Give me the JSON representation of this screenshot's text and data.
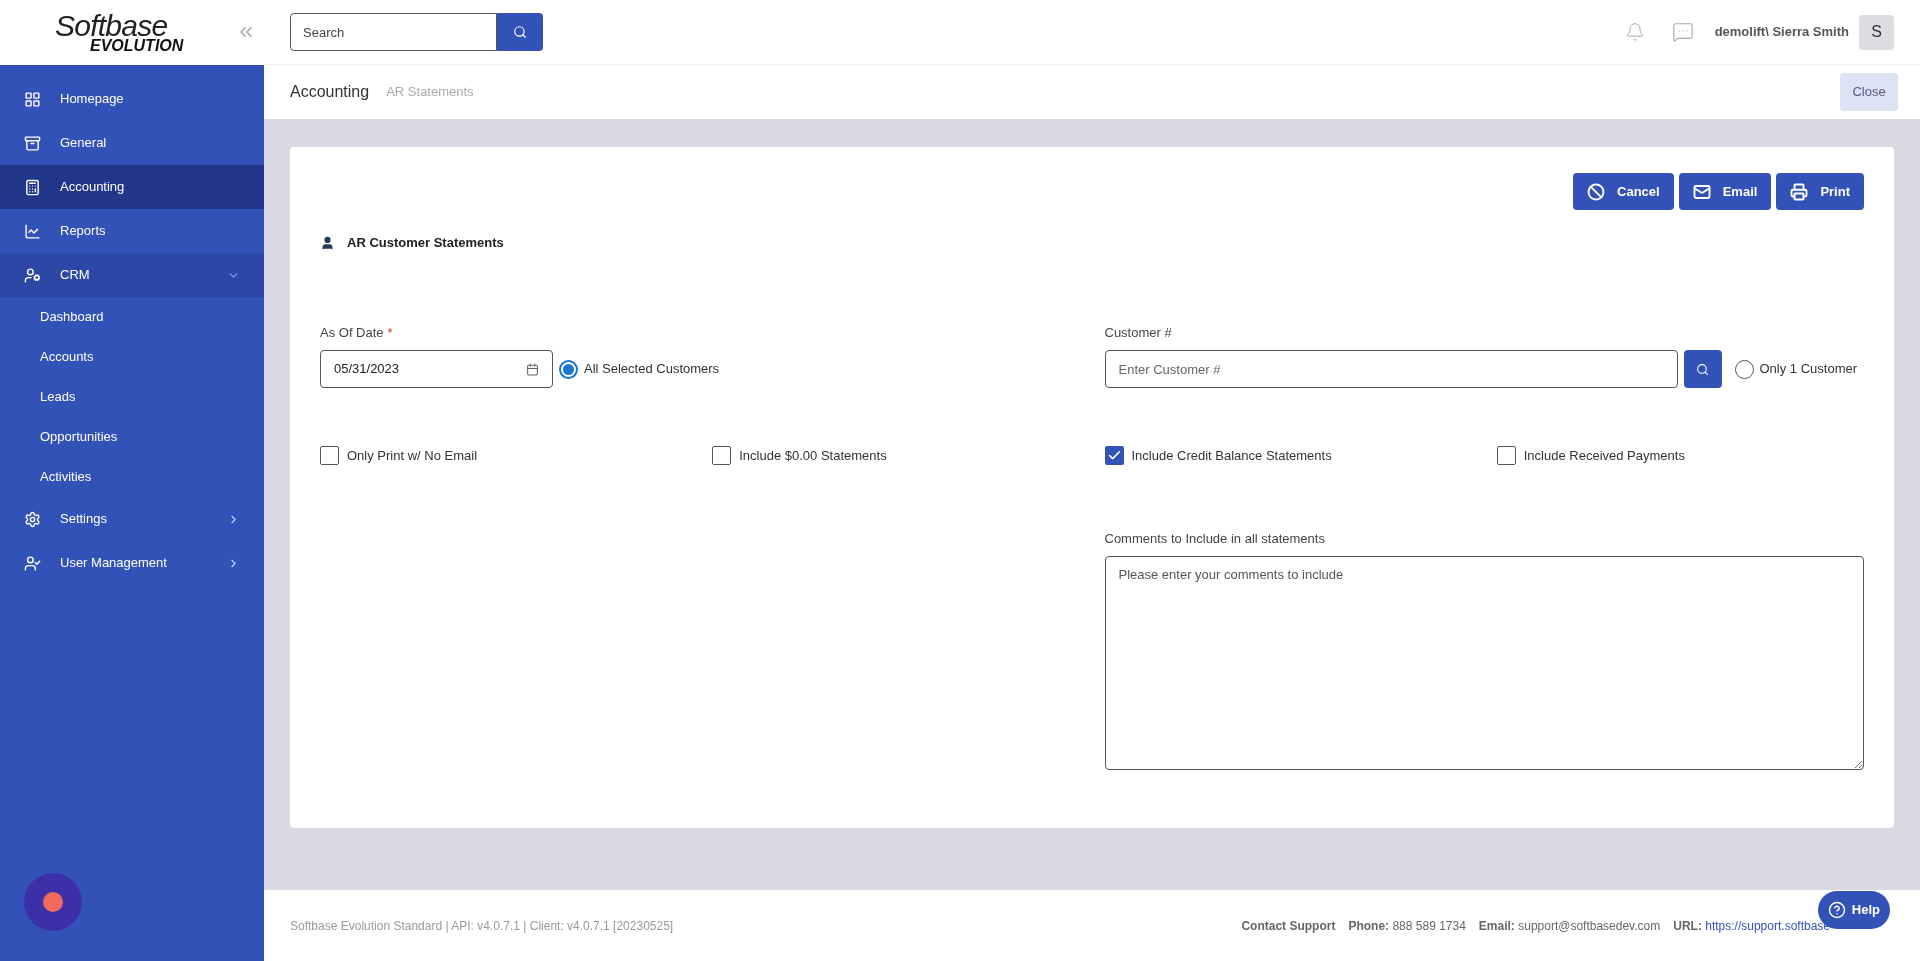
{
  "logo": {
    "line_1": "Softbase",
    "line_2": "EVOLUTION"
  },
  "search": {
    "placeholder": "Search"
  },
  "user": {
    "name": "demolift\\ Sierra Smith",
    "initial": "S"
  },
  "sidebar": {
    "items": [
      {
        "label": "Homepage",
        "selected": false
      },
      {
        "label": "General",
        "selected": false
      },
      {
        "label": "Accounting",
        "selected": true
      },
      {
        "label": "Reports",
        "selected": false
      },
      {
        "label": "CRM",
        "selected": false,
        "expanded": true,
        "children": [
          {
            "label": "Dashboard"
          },
          {
            "label": "Accounts"
          },
          {
            "label": "Leads"
          },
          {
            "label": "Opportunities"
          },
          {
            "label": "Activities"
          }
        ]
      },
      {
        "label": "Settings",
        "selected": false,
        "expanded": false
      },
      {
        "label": "User Management",
        "selected": false,
        "expanded": false
      }
    ]
  },
  "breadcrumb": [
    "Accounting",
    "AR Statements"
  ],
  "close_button": "Close",
  "form": {
    "title": "AR Customer Statements",
    "actions": [
      {
        "kind": "cancel",
        "label": "Cancel"
      },
      {
        "kind": "email",
        "label": "Email"
      },
      {
        "kind": "print",
        "label": "Print"
      }
    ],
    "as_of_date": {
      "label": "As Of Date",
      "required": true,
      "required_mark": "*",
      "value": "05/31/2023"
    },
    "all_customers_radio": {
      "label": "All Selected Customers",
      "selected": true
    },
    "customer": {
      "label": "Customer #",
      "placeholder": "Enter Customer #"
    },
    "one_customer_radio": {
      "label": "Only 1 Customer",
      "selected": false
    },
    "checkboxes": [
      {
        "label": "Only Print w/ No Email",
        "checked": false
      },
      {
        "label": "Include $0.00 Statements",
        "checked": false
      },
      {
        "label": "Include Credit Balance Statements",
        "checked": true
      },
      {
        "label": "Include Received Payments",
        "checked": false
      }
    ],
    "comments": {
      "label": "Comments to Include in all statements",
      "placeholder": "Please enter your comments to include"
    }
  },
  "footer": {
    "version": "Softbase Evolution Standard | API: v4.0.7.1 | Client: v4.0.7.1 [20230525]",
    "contact": "Contact Support",
    "fields": [
      {
        "label": "Phone:",
        "value": "888 589 1734"
      },
      {
        "label": "Email:",
        "value": "support@softbasedev.com"
      },
      {
        "label": "URL:",
        "value": "https://support.softbase",
        "kind": "link"
      }
    ]
  },
  "help_button": "Help"
}
